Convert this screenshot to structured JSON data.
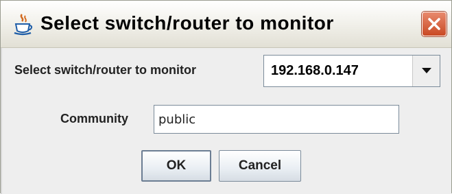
{
  "window": {
    "title": "Select switch/router to monitor",
    "app_icon": "java-cup-icon",
    "close_icon": "close-icon"
  },
  "form": {
    "device_label": "Select switch/router to monitor",
    "device_selected": "192.168.0.147",
    "community_label": "Community",
    "community_value": "public"
  },
  "buttons": {
    "ok_label": "OK",
    "cancel_label": "Cancel"
  },
  "colors": {
    "close_button": "#c94a24",
    "dialog_background": "#eeeeee",
    "titlebar": "#f4f3ee"
  }
}
